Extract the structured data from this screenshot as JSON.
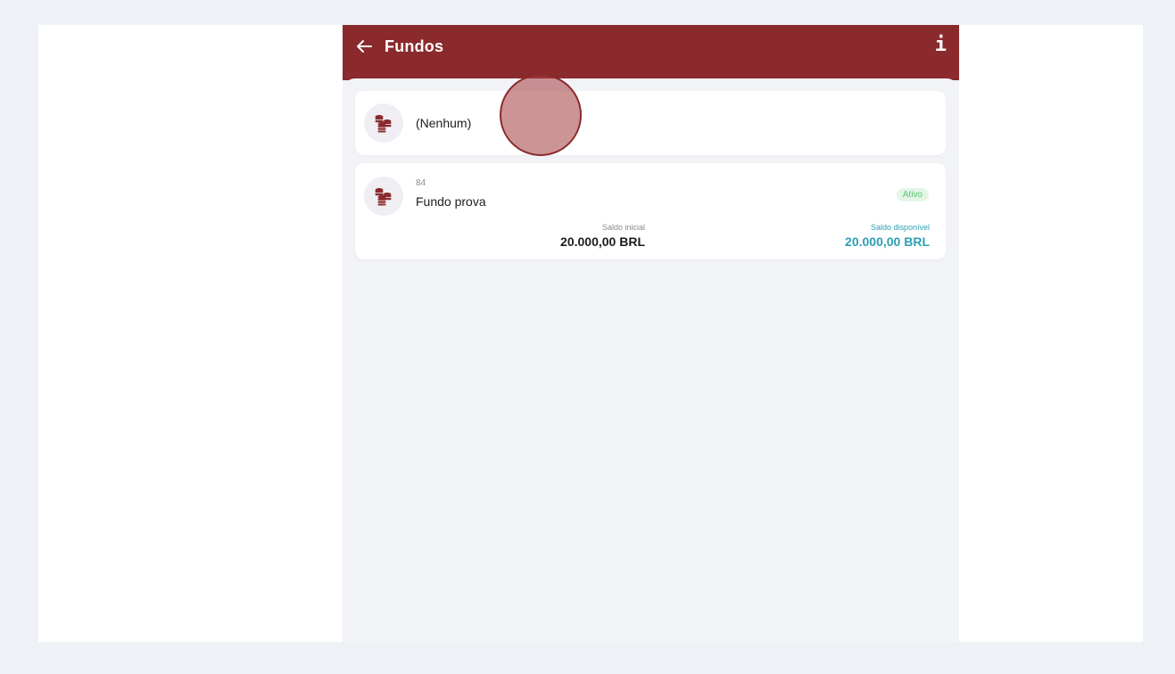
{
  "header": {
    "title": "Fundos",
    "info_label": "i",
    "color": "#8a2a2c"
  },
  "funds": [
    {
      "name": "(Nenhum)",
      "icon": "coins-icon"
    },
    {
      "code": "84",
      "name": "Fundo prova",
      "status": "Ativo",
      "saldo_inicial_label": "Saldo inicial",
      "saldo_inicial": "20.000,00 BRL",
      "saldo_disponivel_label": "Saldo disponível",
      "saldo_disponivel": "20.000,00 BRL",
      "icon": "coins-icon"
    }
  ],
  "colors": {
    "accent": "#8a2a2c",
    "available": "#2e9fb4",
    "status_active": "#5cc46d",
    "background": "#f1f3f7"
  }
}
